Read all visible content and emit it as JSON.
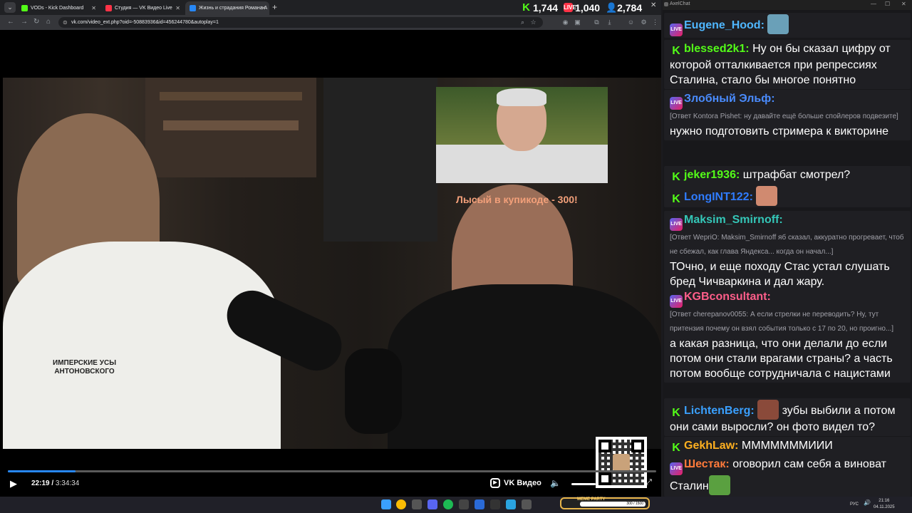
{
  "browser": {
    "tabs": [
      {
        "label": "VODs - Kick Dashboard",
        "favicon_color": "#53fc18"
      },
      {
        "label": "Студия — VK Видео Live",
        "favicon_color": "#ff3347"
      },
      {
        "label": "Жизнь и страдания Романа А",
        "favicon_color": "#2787f5"
      }
    ],
    "url": "vk.com/video_ext.php?oid=-50883936&id=456244780&autoplay=1"
  },
  "counters": [
    {
      "icon": "kick-icon",
      "value": "1,744",
      "color": "#53fc18"
    },
    {
      "icon": "vk-live-icon",
      "value": "1,040",
      "color": "#ff3347"
    },
    {
      "icon": "viewers-icon",
      "value": "2,784",
      "color": "#3aa0ff"
    }
  ],
  "video": {
    "overlay_caption": "Лысый в купикоде - 300!",
    "current_time": "22:19",
    "duration": "3:34:34",
    "progress_fraction": 0.104,
    "brand": "VK Видео",
    "volume_fraction": 0.4,
    "shirt_text_1": "ИМПЕРСКИЕ УСЫ",
    "shirt_text_2": "АНТОНОВСКОГО"
  },
  "chat": {
    "window_title": "AxelChat",
    "messages": [
      {
        "platform": "live",
        "user": "Eugene_Hood:",
        "user_color": "#4fb7ff",
        "reply": "",
        "text": "",
        "emote": true
      },
      {
        "platform": "kick",
        "user": "blessed2k1:",
        "user_color": "#53fc18",
        "reply": "",
        "text": "Ну он бы сказал цифру от которой отталкивается при репрессиях Сталина, стало бы многое понятно",
        "emote": false
      },
      {
        "platform": "live",
        "user": "Злобный Эльф:",
        "user_color": "#4a8cff",
        "reply": "[Ответ Kontora Pishet: ну давайте ещё больше спойлеров подвезите]",
        "text": "нужно подготовить стримера к викторине",
        "emote": false
      },
      {
        "platform": "kick",
        "user": "jeker1936:",
        "user_color": "#53fc18",
        "reply": "",
        "text": "штрафбат смотрел?",
        "emote": false
      },
      {
        "platform": "kick",
        "user": "LongINT122:",
        "user_color": "#2f7cff",
        "reply": "",
        "text": "",
        "emote": true
      },
      {
        "platform": "live",
        "user": "Maksim_Smirnoff:",
        "user_color": "#34c7b8",
        "reply": "[Ответ WepriO: Maksim_Smirnoff яб сказал, аккуратно прогревает, чтоб не сбежал, как глава Яндекса... когда он начал...]",
        "text": "ТОчно, и еще походу Стас устал слушать бред Чичваркина и дал жару.",
        "emote": false
      },
      {
        "platform": "live",
        "user": "KGBconsultant:",
        "user_color": "#ff5e8a",
        "reply": "[Ответ cherepanov0055: А если стрелки не переводить? Ну, тут притензия почему он взял события только с 17 по 20, но проигно...]",
        "text": "а какая разница, что они делали до если потом они стали врагами страны? а часть потом вообще сотрудничала с нацистами",
        "emote": false
      },
      {
        "platform": "kick",
        "user": "LichtenBerg:",
        "user_color": "#3aa0ff",
        "reply": "",
        "text": "зубы выбили а потом они сами выросли? он фото видел то?",
        "emote": true
      },
      {
        "platform": "kick",
        "user": "GekhLaw:",
        "user_color": "#ffb020",
        "reply": "",
        "text": "МММММММИИИ",
        "emote": false
      },
      {
        "platform": "live",
        "user": "Шестак:",
        "user_color": "#ff7a3a",
        "reply": "",
        "text": "оговорил сам себя а виноват Сталин",
        "emote": true
      }
    ]
  },
  "taskbar": {
    "meme_label": "MEME PARTY",
    "meme_count": "300 / 1500",
    "lang": "РУС",
    "time": "21:16",
    "date": "04.11.2025"
  }
}
